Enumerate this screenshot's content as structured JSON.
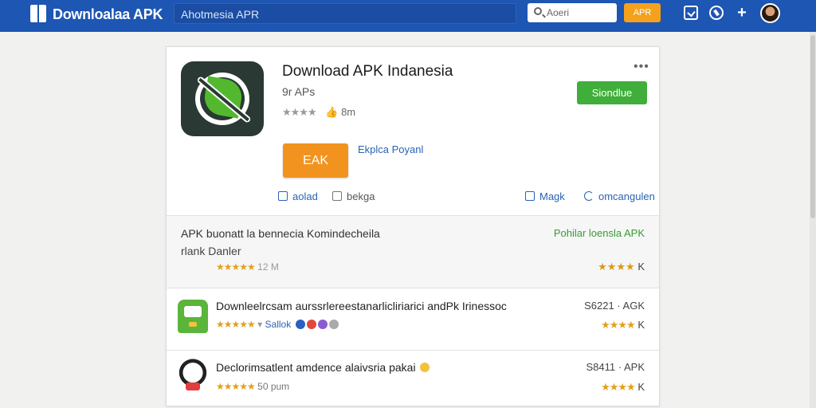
{
  "header": {
    "brand": "Downloalaa APK",
    "search_value": "Ahotmesia APR",
    "search_small_placeholder": "Aoeri",
    "orange_button": "APR"
  },
  "app": {
    "title": "Download APK Indanesia",
    "subtitle": "9r APs",
    "stars": "★★★★",
    "rating_count": "8m",
    "more": "•••",
    "green_button": "Siondlue",
    "main_button": "EAK",
    "explore_link": "Ekplca Poyanl",
    "actions": {
      "left1": "aolad",
      "left2": "bekga",
      "right1": "Magk",
      "right2": "omcangulen"
    }
  },
  "featured": {
    "title": "APK buonatt la bennecia Komindecheila",
    "subtitle": "rlank Danler",
    "stars": "★★★★★",
    "rating_text": "12 M",
    "green_text": "Pohilar loensla APK",
    "right_stars": "★★★★",
    "right_text": "K"
  },
  "rows": [
    {
      "title": "Downleelrcsam aurssrlereestanarlicliriarici andPk Irinessoc",
      "stars": "★★★★★",
      "meta": "Sallok",
      "price": "S6221 · AGK",
      "right_stars": "★★★★",
      "right_text": "K"
    },
    {
      "title": "Declorimsatlent amdence alaivsria pakai",
      "stars": "★★★★★",
      "meta": "50 pum",
      "price": "S8411 · APK",
      "right_stars": "★★★★",
      "right_text": "K"
    }
  ]
}
